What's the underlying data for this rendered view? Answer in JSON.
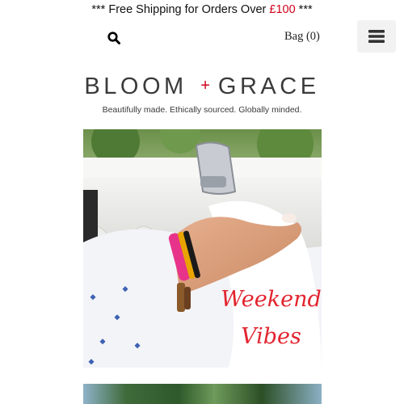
{
  "announcement": {
    "prefix": "*** Free Shipping for Orders Over ",
    "amount": "£100",
    "suffix": " ***"
  },
  "header": {
    "search_icon": "search-icon",
    "bag_label": "Bag (0)",
    "menu_icon": "hamburger-menu-icon"
  },
  "brand": {
    "logo_left": "BLOOM",
    "logo_plus": "+",
    "logo_right": "GRACE",
    "tagline": "Beautifully made. Ethically sourced. Globally minded."
  },
  "hero": {
    "caption_line1": "Weekend",
    "caption_line2": "Vibes"
  },
  "colors": {
    "accent": "#d0021b",
    "caption": "#e2242f",
    "menu_bg": "#f2f2f2"
  }
}
